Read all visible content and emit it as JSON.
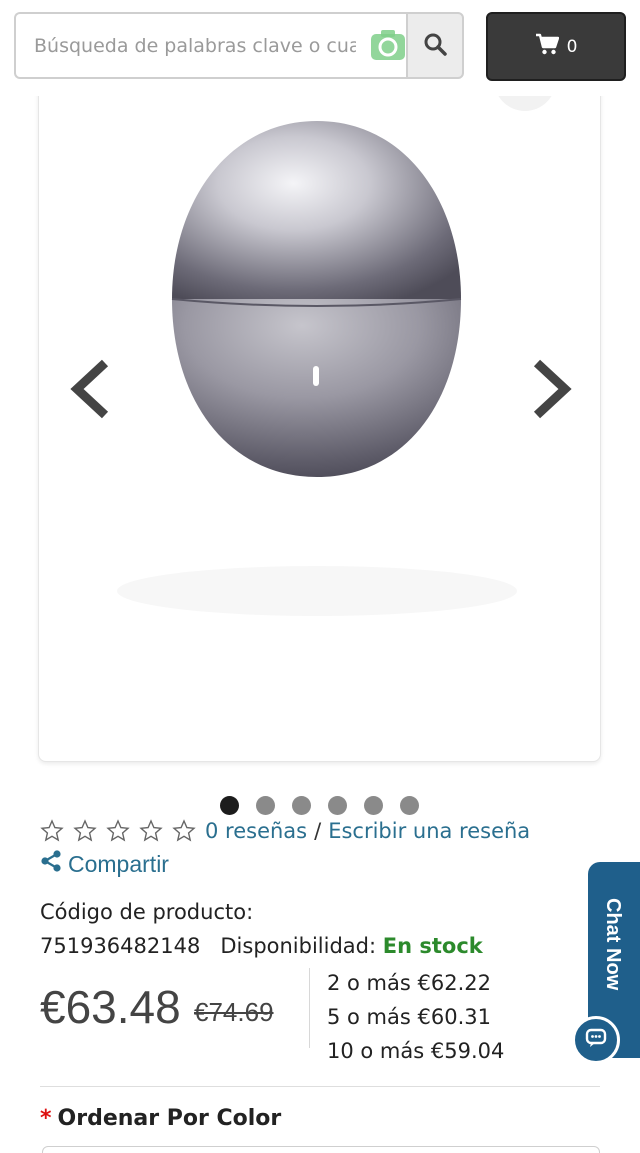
{
  "header": {
    "search_placeholder": "Búsqueda de palabras clave o cualqui",
    "cart_count": "0"
  },
  "gallery": {
    "slide_count": 6,
    "active_index": 0
  },
  "rating": {
    "stars_filled": 0,
    "stars_total": 5,
    "reviews_text": "0 reseñas",
    "separator": "/",
    "write_review_text": "Escribir una reseña"
  },
  "share_text": "Compartir",
  "product": {
    "code_label": "Código de producto:",
    "code_value": "751936482148",
    "availability_label": "Disponibilidad:",
    "availability_value": "En stock",
    "price": "€63.48",
    "old_price": "€74.69",
    "tiers": [
      "2 o más €62.22",
      "5 o más €60.31",
      "10 o más €59.04"
    ]
  },
  "options": {
    "required_mark": "*",
    "color_label": "Ordenar Por Color"
  },
  "chat": {
    "label": "Chat Now"
  },
  "colors": {
    "link": "#2a6f8f",
    "stock": "#2c8a2c",
    "cart_bg": "#3a3a3a",
    "chat_bg": "#1f5f8b"
  }
}
